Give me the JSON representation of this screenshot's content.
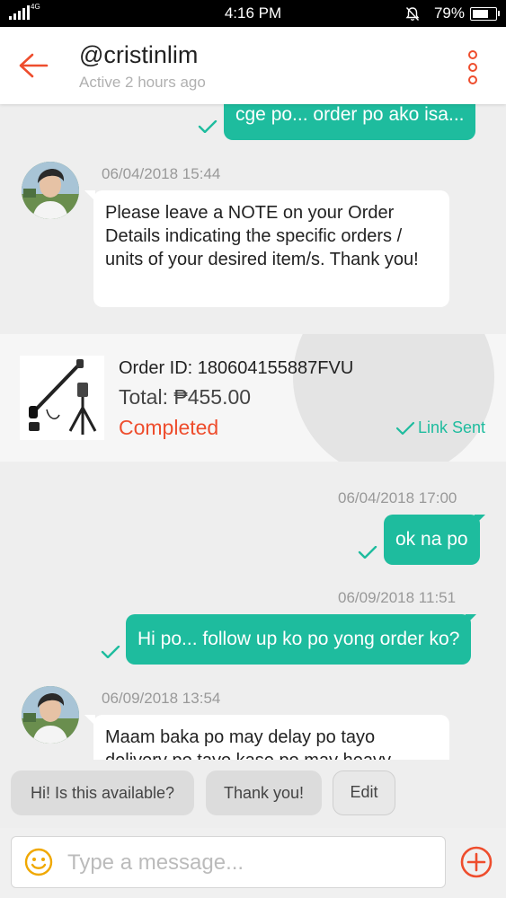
{
  "status_bar": {
    "network": "4G",
    "time": "4:16 PM",
    "battery": "79%",
    "battery_level": 0.79
  },
  "header": {
    "username": "@cristinlim",
    "active": "Active 2 hours ago"
  },
  "messages": [
    {
      "type": "out",
      "text": "cge po... order po ako isa..."
    },
    {
      "type": "in",
      "timestamp": "06/04/2018 15:44",
      "text": "Please leave a NOTE on your Order Details indicating the specific orders / units of your desired item/s. Thank you!"
    },
    {
      "type": "out",
      "timestamp": "06/04/2018 17:00",
      "text": "ok na po"
    },
    {
      "type": "out",
      "timestamp": "06/09/2018 11:51",
      "text": "Hi po... follow up ko po yong order ko?"
    },
    {
      "type": "in",
      "timestamp": "06/09/2018 13:54",
      "text": "Maam baka po may delay po tayo",
      "text2": "delivery po tayo kase po may heavy"
    }
  ],
  "order": {
    "id": "Order ID: 180604155887FVU",
    "total": "Total: ₱455.00",
    "status": "Completed",
    "link_status": "Link Sent"
  },
  "quick_replies": [
    "Hi! Is this available?",
    "Thank you!",
    "Edit"
  ],
  "composer": {
    "placeholder": "Type a message..."
  },
  "colors": {
    "accent": "#ee4d2d",
    "bubble_out": "#1ebc9e",
    "background": "#eeeeee"
  }
}
